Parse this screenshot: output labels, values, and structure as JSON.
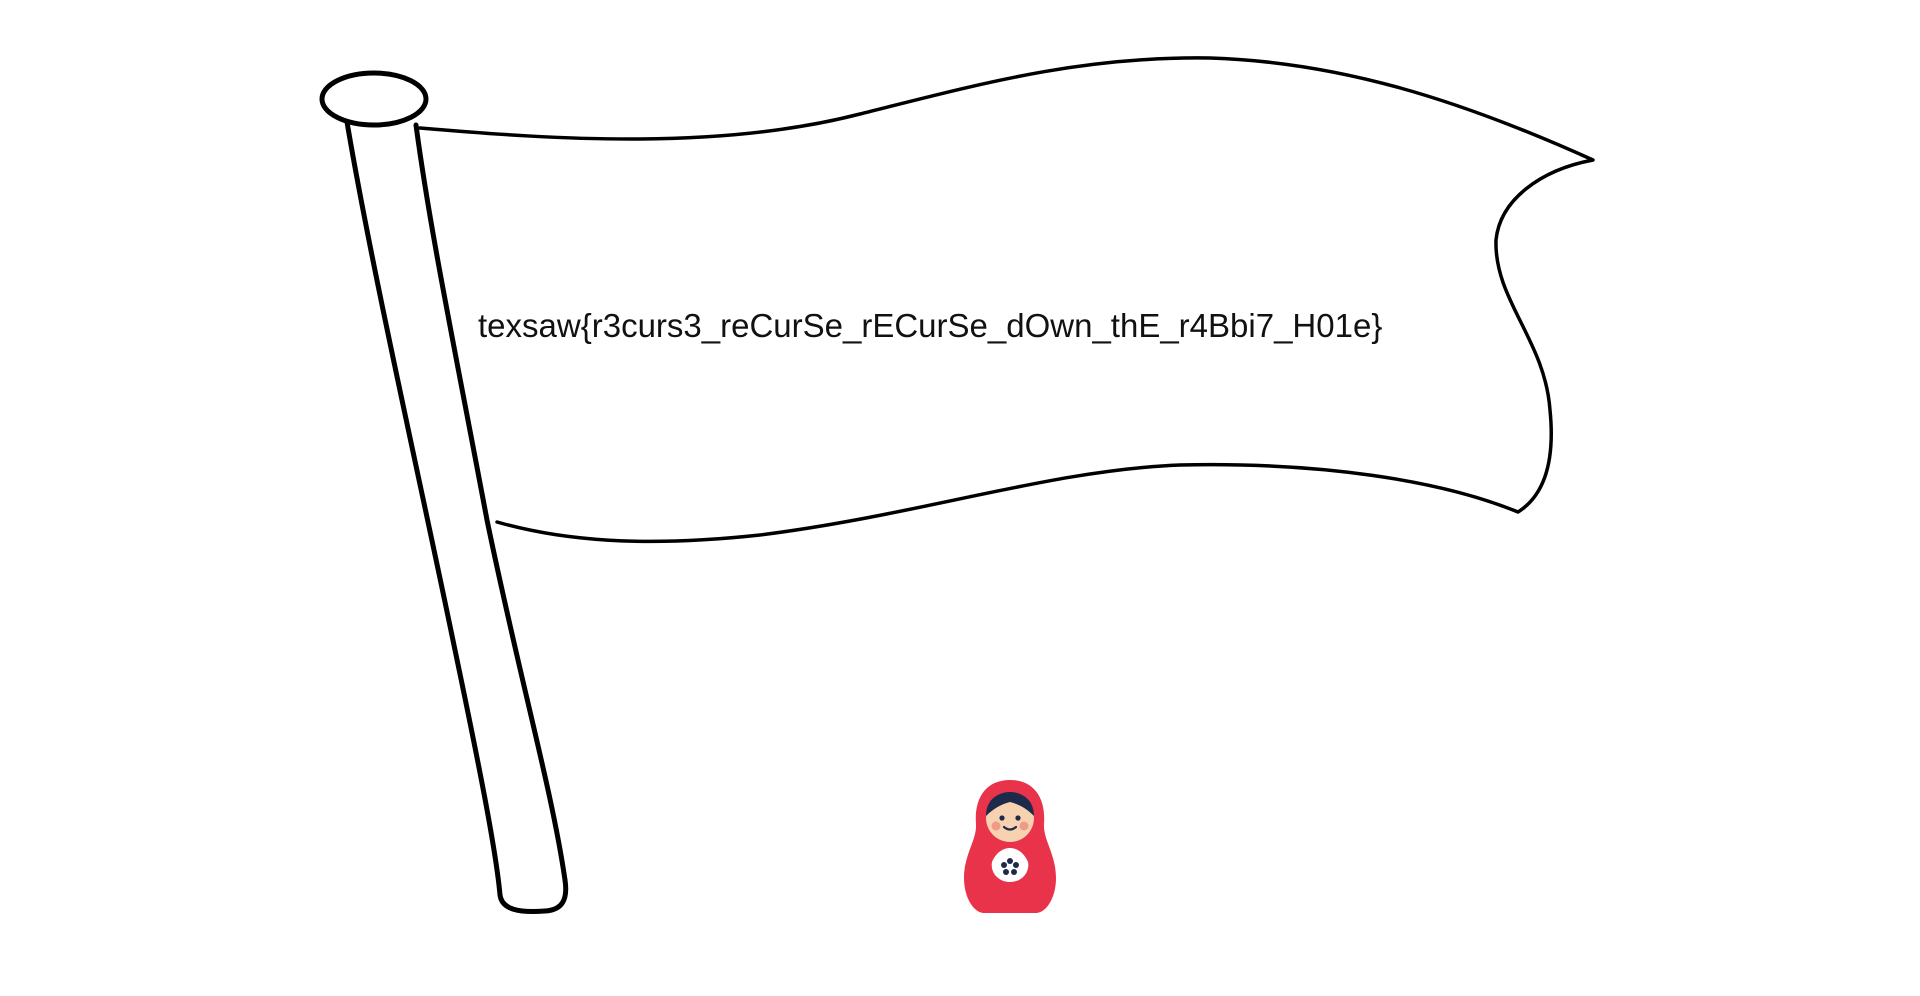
{
  "flag": {
    "text": "texsaw{r3curs3_reCurSe_rECurSe_dOwn_thE_r4Bbi7_H01e}"
  },
  "doll": {
    "icon": "matryoshka-doll-icon",
    "colors": {
      "body": "#e8334a",
      "face": "#f6d2b0",
      "hair": "#1e2a4a",
      "cheeks": "#f09a8a",
      "apron": "#ffffff",
      "flower": "#1e2a4a"
    }
  },
  "colors": {
    "outline": "#000000",
    "background": "#ffffff"
  }
}
